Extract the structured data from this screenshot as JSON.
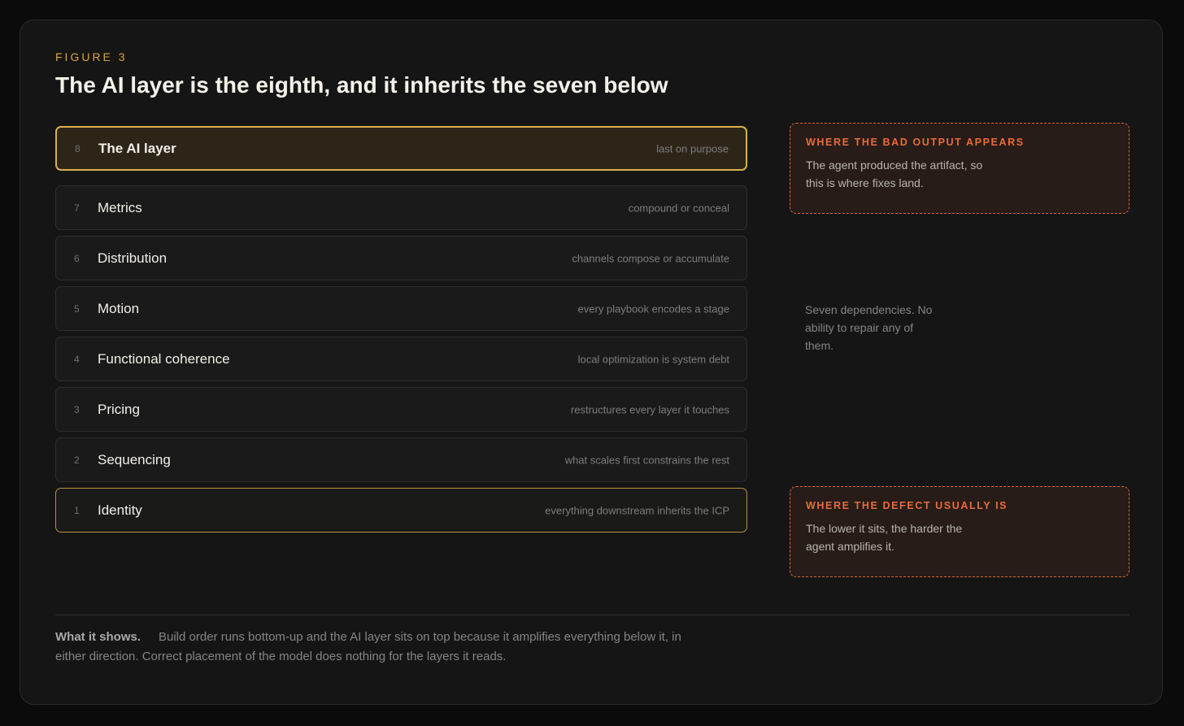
{
  "figure_label": "FIGURE 3",
  "title": "The AI layer is the eighth, and it inherits the seven below",
  "layers": [
    {
      "num": "8",
      "name": "The AI layer",
      "note": "last on purpose"
    },
    {
      "num": "7",
      "name": "Metrics",
      "note": "compound or conceal"
    },
    {
      "num": "6",
      "name": "Distribution",
      "note": "channels compose or accumulate"
    },
    {
      "num": "5",
      "name": "Motion",
      "note": "every playbook encodes a stage"
    },
    {
      "num": "4",
      "name": "Functional coherence",
      "note": "local optimization is system debt"
    },
    {
      "num": "3",
      "name": "Pricing",
      "note": "restructures every layer it touches"
    },
    {
      "num": "2",
      "name": "Sequencing",
      "note": "what scales first constrains the rest"
    },
    {
      "num": "1",
      "name": "Identity",
      "note": "everything downstream inherits the ICP"
    }
  ],
  "callout_top": {
    "heading": "WHERE THE BAD OUTPUT APPEARS",
    "body": "The agent produced the artifact, so this is where fixes land."
  },
  "middle_note": "Seven dependencies. No ability to repair any of them.",
  "callout_bottom": {
    "heading": "WHERE THE DEFECT USUALLY IS",
    "body": "The lower it sits, the harder the agent amplifies it."
  },
  "footer": {
    "label": "What it shows.",
    "text": "Build order runs bottom-up and the AI layer sits on top because it amplifies everything below it, in either direction. Correct placement of the model does nothing for the layers it reads."
  },
  "colors": {
    "accent_gold": "#d9b04a",
    "accent_orange": "#e86c3c",
    "background": "#151515"
  }
}
